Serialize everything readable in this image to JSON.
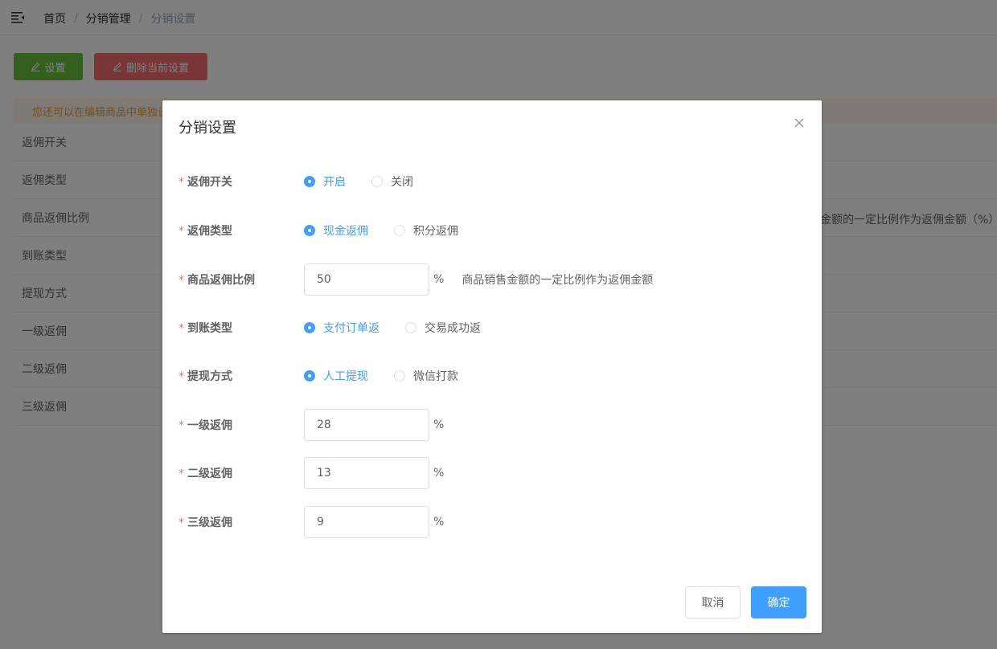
{
  "breadcrumb": [
    "首页",
    "分销管理",
    "分销设置"
  ],
  "toolbar": {
    "set_label": "设置",
    "delete_label": "删除当前设置"
  },
  "notice": "您还可以在编辑商品中单独设",
  "bg_table": {
    "rows": [
      "返佣开关",
      "返佣类型",
      "商品返佣比例",
      "到账类型",
      "提现方式",
      "一级返佣",
      "二级返佣",
      "三级返佣"
    ],
    "ratio_note": "金额的一定比例作为返佣金额（%）"
  },
  "dialog": {
    "title": "分销设置",
    "fields": {
      "switch": {
        "label": "返佣开关",
        "options": [
          "开启",
          "关闭"
        ],
        "selected": "开启"
      },
      "type": {
        "label": "返佣类型",
        "options": [
          "现金返佣",
          "积分返佣"
        ],
        "selected": "现金返佣"
      },
      "ratio": {
        "label": "商品返佣比例",
        "value": "50",
        "unit": "%",
        "hint": "商品销售金额的一定比例作为返佣金额"
      },
      "arrival": {
        "label": "到账类型",
        "options": [
          "支付订单返",
          "交易成功返"
        ],
        "selected": "支付订单返"
      },
      "withdraw": {
        "label": "提现方式",
        "options": [
          "人工提现",
          "微信打款"
        ],
        "selected": "人工提现"
      },
      "level1": {
        "label": "一级返佣",
        "value": "28",
        "unit": "%"
      },
      "level2": {
        "label": "二级返佣",
        "value": "13",
        "unit": "%"
      },
      "level3": {
        "label": "三级返佣",
        "value": "9",
        "unit": "%"
      }
    },
    "cancel_label": "取消",
    "confirm_label": "确定"
  },
  "colors": {
    "primary": "#409eff",
    "success": "#67c23a",
    "danger": "#f56c6c",
    "warning": "#e6a23c"
  }
}
